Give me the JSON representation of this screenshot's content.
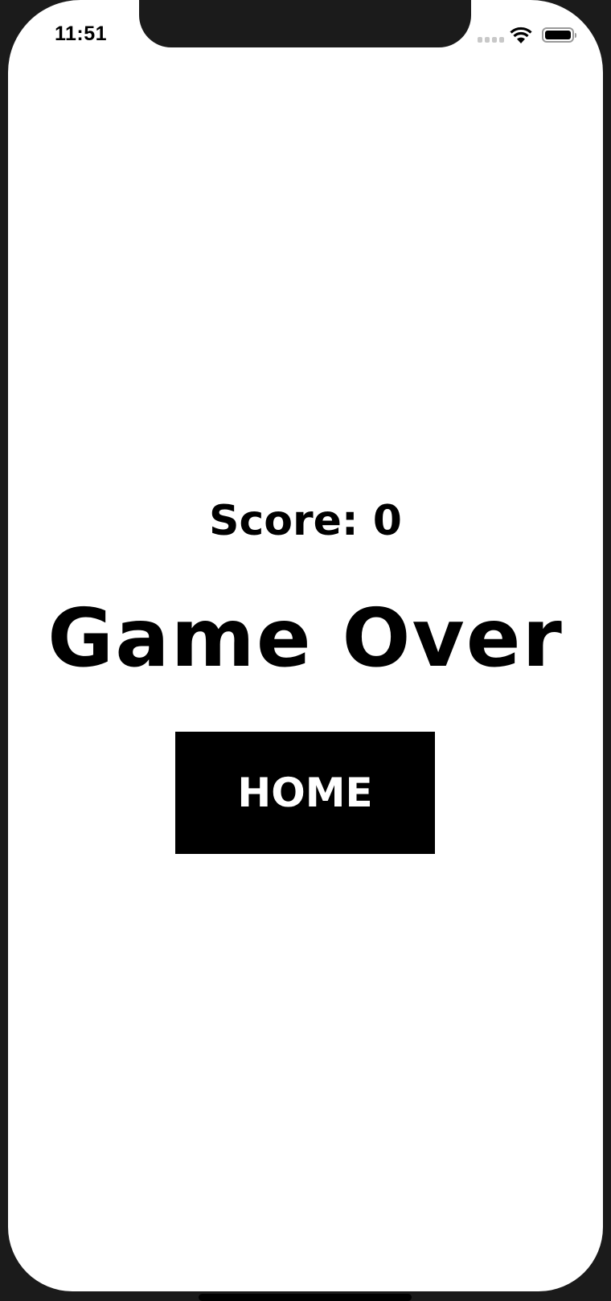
{
  "status_bar": {
    "time": "11:51",
    "icons": [
      "cellular-signal-icon",
      "wifi-icon",
      "battery-icon"
    ]
  },
  "game": {
    "score_text": "Score: 0",
    "title": "Game Over",
    "home_label": "HOME"
  },
  "colors": {
    "background": "#ffffff",
    "button": "#000000",
    "button_text": "#ffffff"
  }
}
